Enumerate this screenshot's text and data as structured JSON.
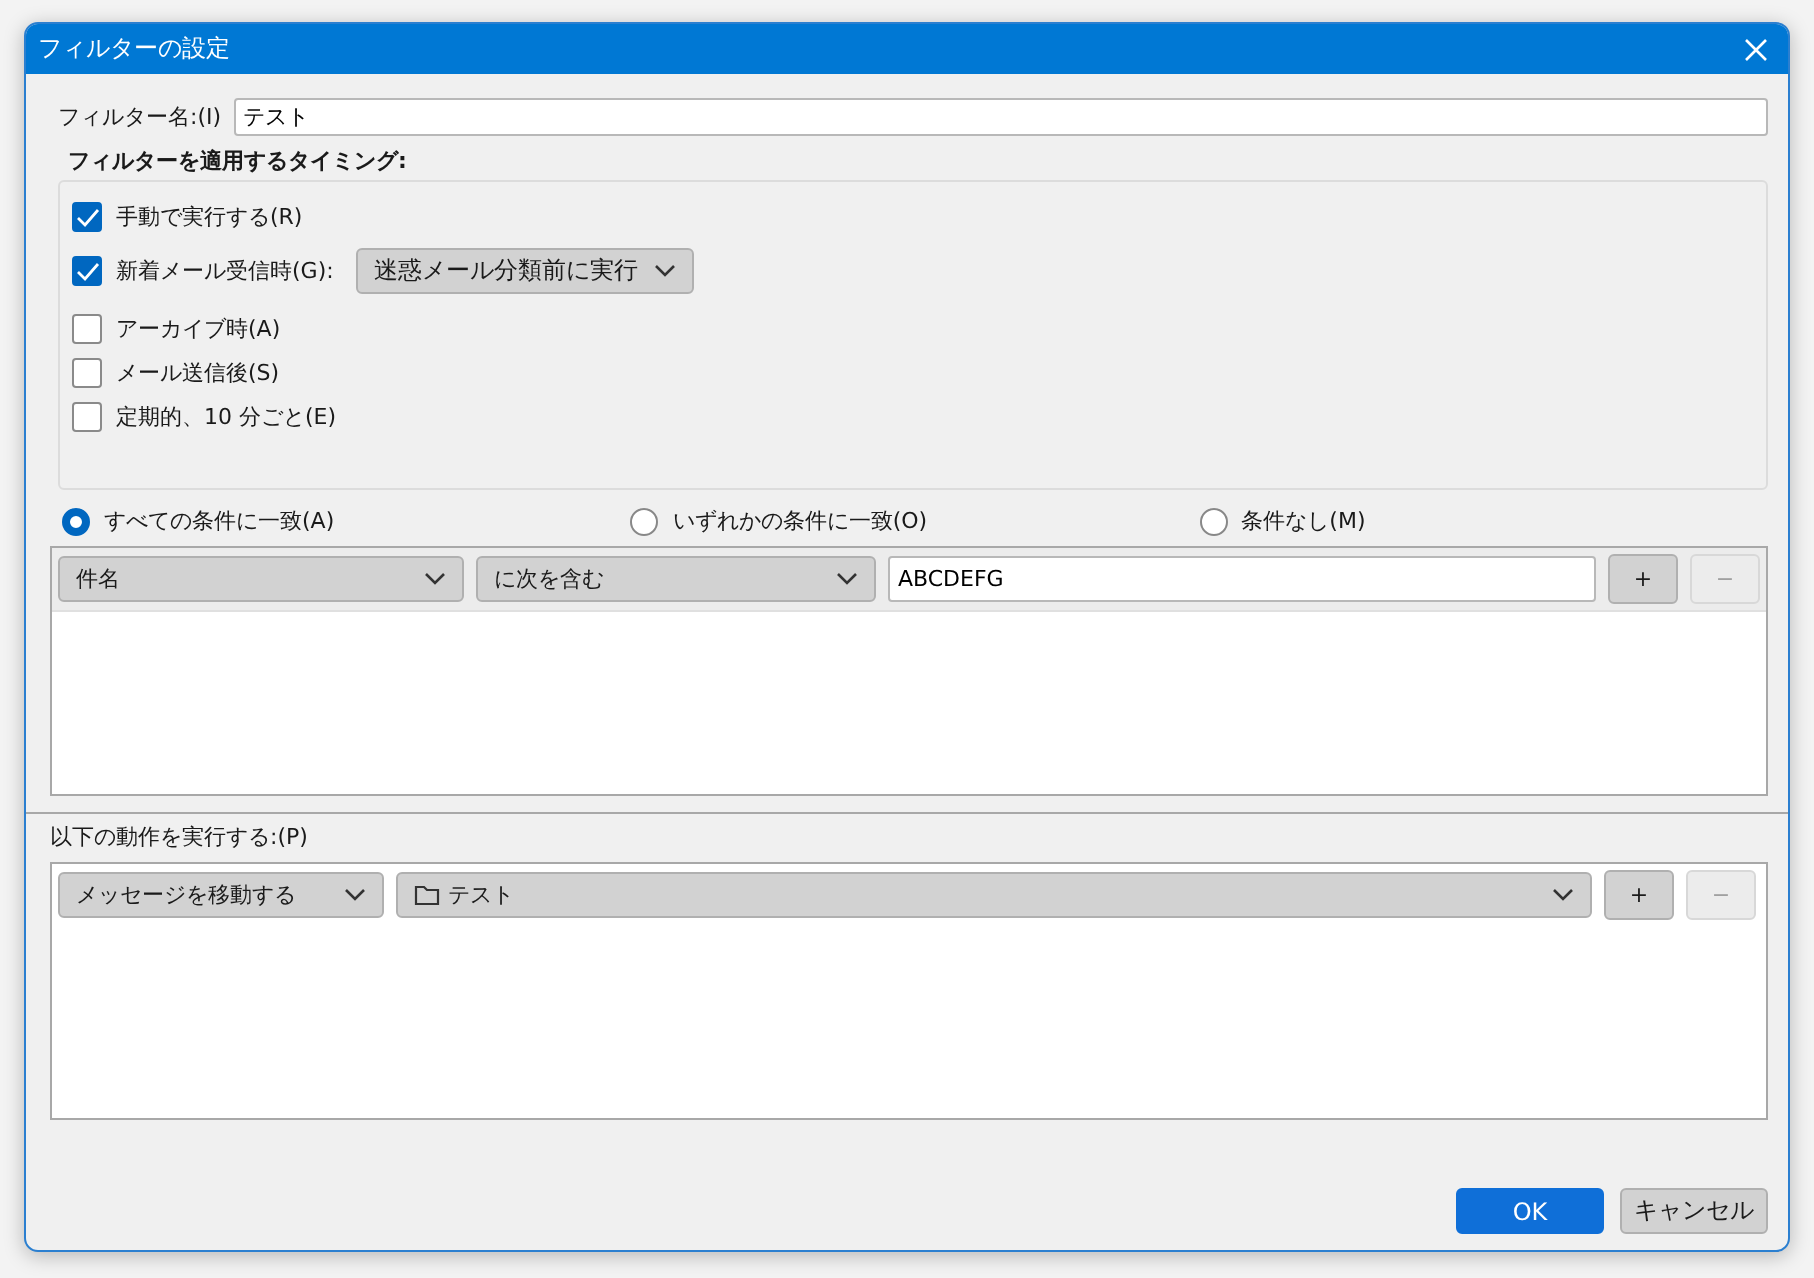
{
  "window": {
    "title": "フィルターの設定"
  },
  "filter_name": {
    "label": "フィルター名:(I)",
    "value": "テスト"
  },
  "timing": {
    "title": "フィルターを適用するタイミング:",
    "options": [
      {
        "label": "手動で実行する(R)",
        "checked": true
      },
      {
        "label": "新着メール受信時(G):",
        "checked": true,
        "dropdown": "迷惑メール分類前に実行"
      },
      {
        "label": "アーカイブ時(A)",
        "checked": false
      },
      {
        "label": "メール送信後(S)",
        "checked": false
      },
      {
        "label": "定期的、10 分ごと(E)",
        "checked": false
      }
    ]
  },
  "match": [
    {
      "label": "すべての条件に一致(A)",
      "selected": true
    },
    {
      "label": "いずれかの条件に一致(O)",
      "selected": false
    },
    {
      "label": "条件なし(M)",
      "selected": false
    }
  ],
  "conditions": [
    {
      "field": "件名",
      "operator": "に次を含む",
      "value": "ABCDEFG",
      "add": "+",
      "remove": "−",
      "remove_disabled": true
    }
  ],
  "actions_title": "以下の動作を実行する:(P)",
  "actions": [
    {
      "action": "メッセージを移動する",
      "target": "テスト",
      "add": "+",
      "remove": "−",
      "remove_disabled": true
    }
  ],
  "buttons": [
    {
      "label": "OK",
      "kind": "primary"
    },
    {
      "label": "キャンセル",
      "kind": "secondary"
    }
  ]
}
